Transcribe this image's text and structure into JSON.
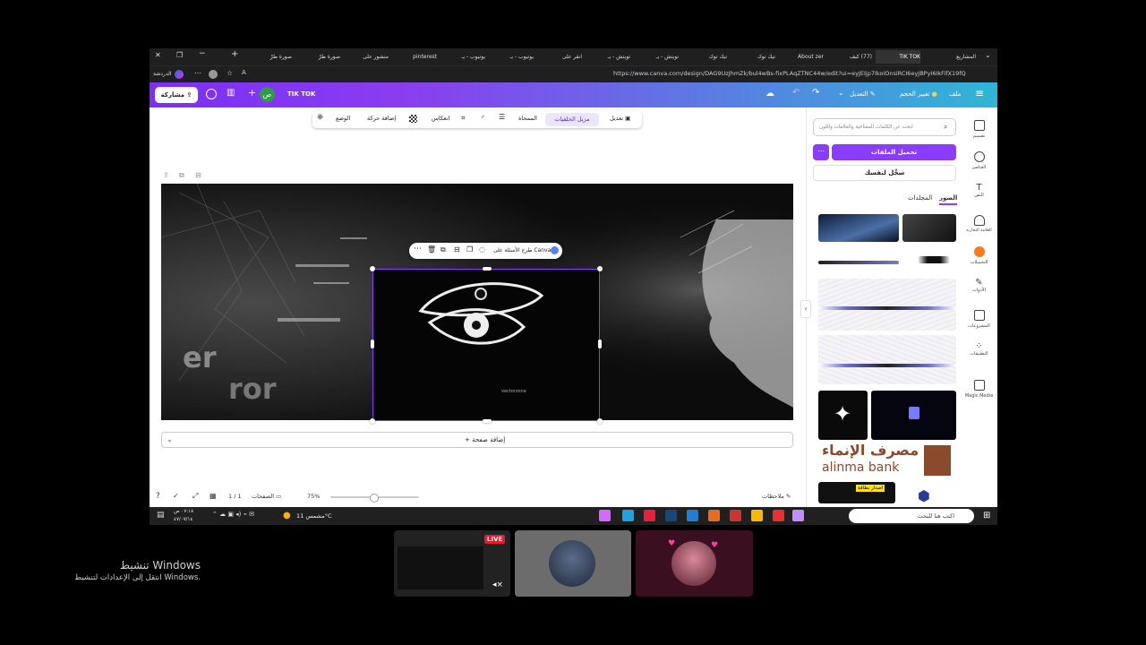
{
  "browser": {
    "tabs": [
      {
        "label": "المشاريع",
        "active": false
      },
      {
        "label": "TIK TOK",
        "active": true
      },
      {
        "label": "(77) كيف",
        "active": false
      },
      {
        "label": "About zer",
        "active": false
      },
      {
        "label": "تيك توك",
        "active": false
      },
      {
        "label": "تيك توك",
        "active": false
      },
      {
        "label": "تويتش - يـ",
        "active": false
      },
      {
        "label": "تويتش - يـ",
        "active": false
      },
      {
        "label": "انقر على",
        "active": false
      },
      {
        "label": "يوتيوب - يـ",
        "active": false
      },
      {
        "label": "يوتيوب - يـ",
        "active": false
      },
      {
        "label": "pinterest",
        "active": false
      },
      {
        "label": "منشور على",
        "active": false
      },
      {
        "label": "صورة طرْ",
        "active": false
      },
      {
        "label": "صورة طرْ",
        "active": false
      }
    ],
    "url": "https://www.canva.com/design/DAG9UzJhmZk/bul4wBs-fixPLAqZTNC44w/edit?ui=eyJEIjp7IkoiOnsiRCI6eyJBPyI6IkFifX19fQ",
    "chat_label": "الدردشة"
  },
  "canva_header": {
    "share_label": "مشاركة",
    "avatar_letter": "ص",
    "design_title": "TIK TOK",
    "edit_label": "التعديل",
    "resize_label": "تغيير الحجم",
    "file_label": "ملف"
  },
  "context_toolbar": {
    "position_label": "الوضع",
    "animate_label": "إضافة حركة",
    "flip_label": "انعكاس",
    "eraser_label": "الممحاة",
    "bg_remover_label": "مزيل الخلفيات",
    "edit_label": "تعديل"
  },
  "canvas": {
    "element_toolbar_label": "طرح الأسئلة على Canva",
    "glitch_text_1": "er",
    "glitch_text_2": "ror",
    "watermark_text": "vectorzone"
  },
  "add_page_label": "+ إضافة صفحة",
  "footer": {
    "notes_label": "ملاحظات",
    "zoom": "75%",
    "pages_label": "الصفحات",
    "page_count": "1 / 1"
  },
  "side_panel": {
    "search_placeholder": "ابحث عن الكلمات المفتاحية والعلامات واللون",
    "upload_label": "تحميل الملفات",
    "record_label": "سجِّل لنفسك",
    "tab_images": "الصور",
    "tab_folders": "المجلدات",
    "alinma_ar": "مصرف الإنماء",
    "alinma_en": "alinma bank",
    "card_sticker": "اصدار بطاقة"
  },
  "rail": [
    {
      "label": "تصميم",
      "icon": "design-icon"
    },
    {
      "label": "العناصر",
      "icon": "elements-icon"
    },
    {
      "label": "النص",
      "icon": "text-icon"
    },
    {
      "label": "العلامة التجارية",
      "icon": "brand-icon"
    },
    {
      "label": "التحميلات",
      "icon": "uploads-icon"
    },
    {
      "label": "الأدوات",
      "icon": "tools-icon"
    },
    {
      "label": "المشروعات",
      "icon": "projects-icon"
    },
    {
      "label": "التطبيقات",
      "icon": "apps-icon"
    },
    {
      "label": "Magic Media",
      "icon": "magic-media-icon"
    }
  ],
  "taskbar": {
    "search_placeholder": "اكتب هنا للبحث",
    "weather": "مشمس 11°C",
    "time": "٠٧:١٨ ص",
    "date": "٤٧/٠٧/١٤"
  },
  "stream": {
    "live_badge": "LIVE"
  },
  "windows_activation": {
    "title": "تنشيط Windows",
    "subtitle": "انتقل إلى الإعدادات لتنشيط Windows."
  },
  "colors": {
    "canva_purple": "#8b3dff",
    "header_gradient_start": "#7b2ff7",
    "header_gradient_end": "#2fb6d6",
    "alinma_brown": "#8a4a2b"
  }
}
